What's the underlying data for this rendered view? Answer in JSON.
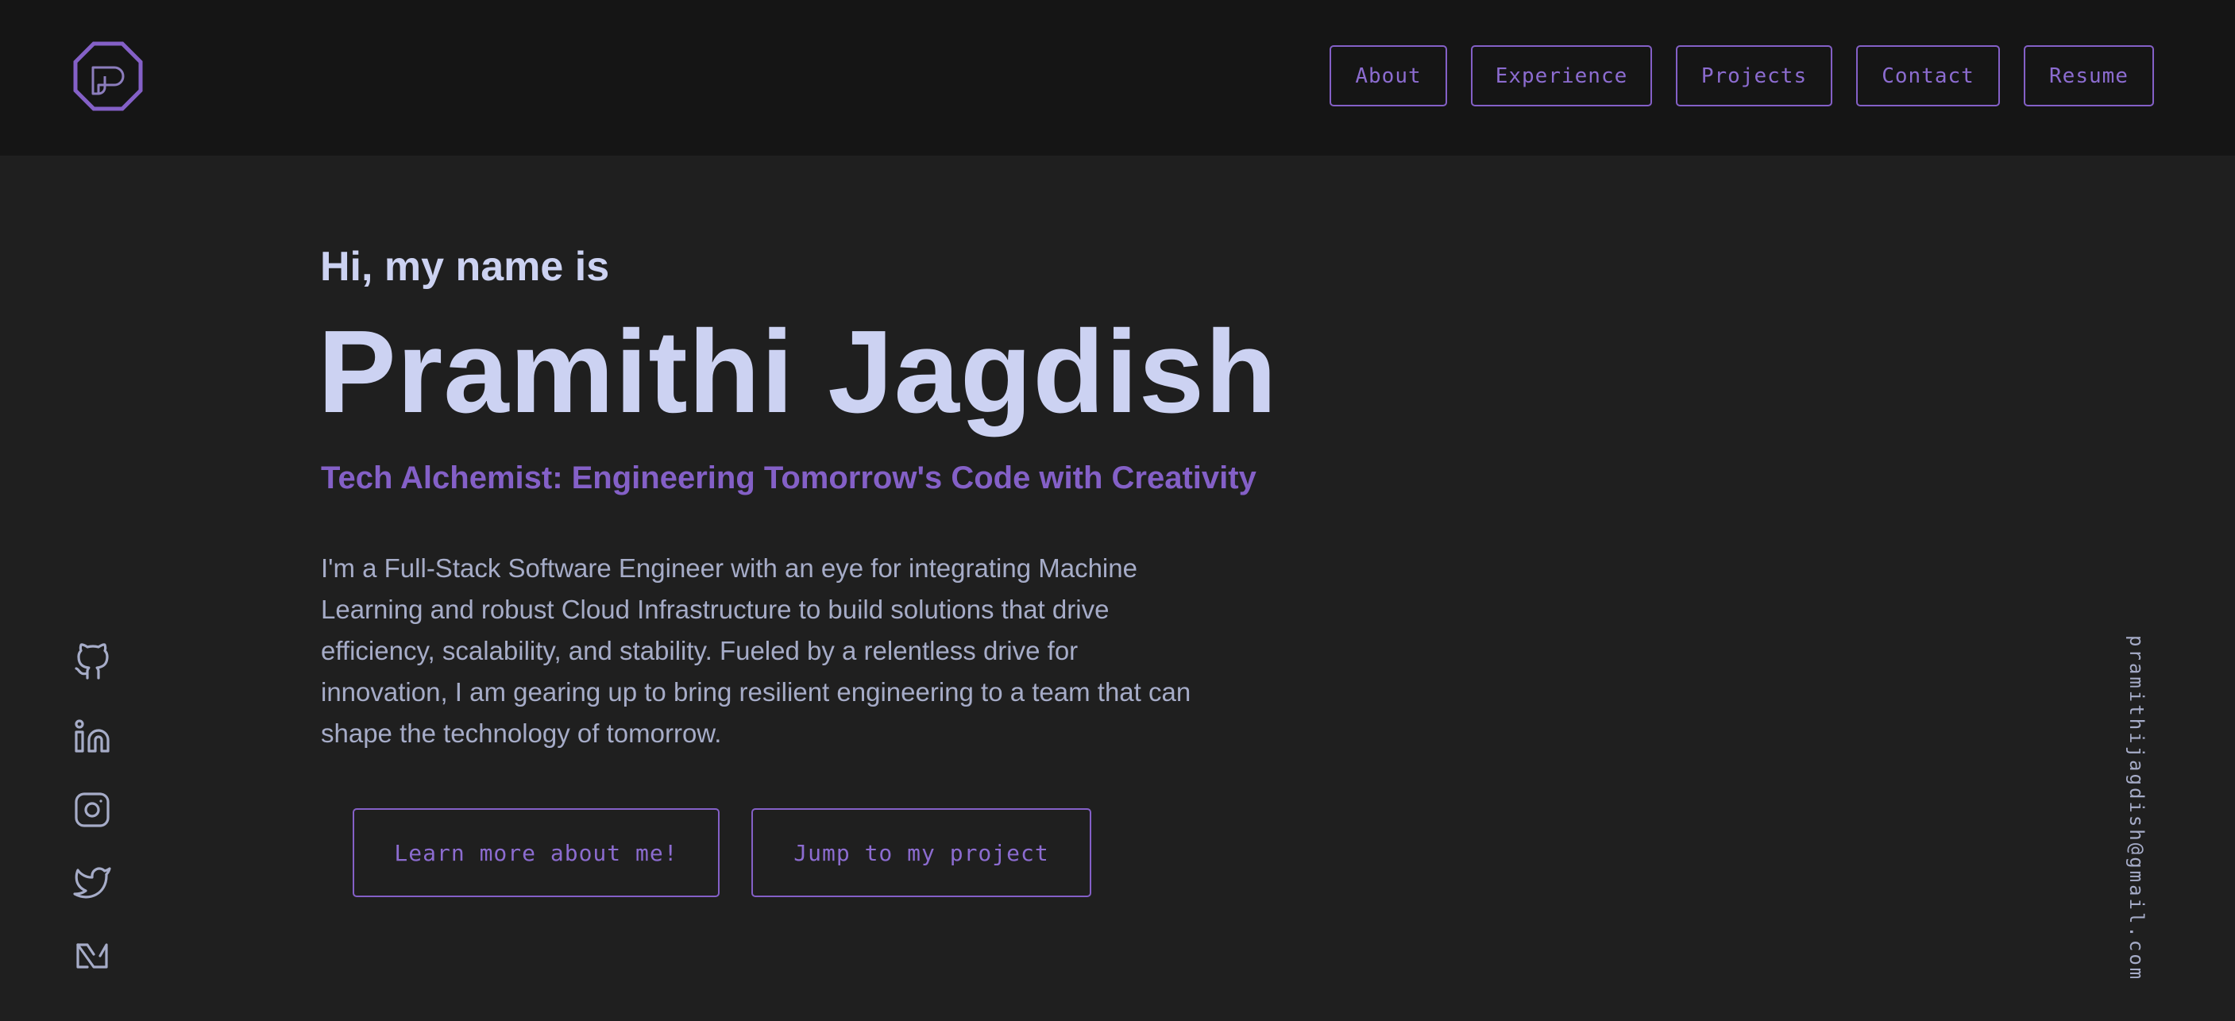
{
  "nav": {
    "about": "About",
    "experience": "Experience",
    "projects": "Projects",
    "contact": "Contact",
    "resume": "Resume"
  },
  "hero": {
    "greeting": "Hi, my name is",
    "name": "Pramithi Jagdish",
    "tagline": "Tech Alchemist: Engineering Tomorrow's Code with Creativity",
    "intro": "I'm a Full-Stack Software Engineer with an eye for integrating Machine Learning and robust Cloud Infrastructure to build solutions that drive efficiency, scalability, and stability. Fueled by a relentless drive for innovation, I am gearing up to bring resilient engineering to a team that can shape the technology of tomorrow.",
    "learn_more": "Learn more about me!",
    "jump_project": "Jump to my project"
  },
  "social": {
    "icons": [
      "github-icon",
      "linkedin-icon",
      "instagram-icon",
      "twitter-icon",
      "medium-icon"
    ]
  },
  "email": "pramithijagdish@gmail.com",
  "colors": {
    "background": "#1f1f1f",
    "header_background": "#151515",
    "accent": "#8460c7",
    "heading": "#ccd2f2",
    "body_text": "#a6acc8"
  }
}
